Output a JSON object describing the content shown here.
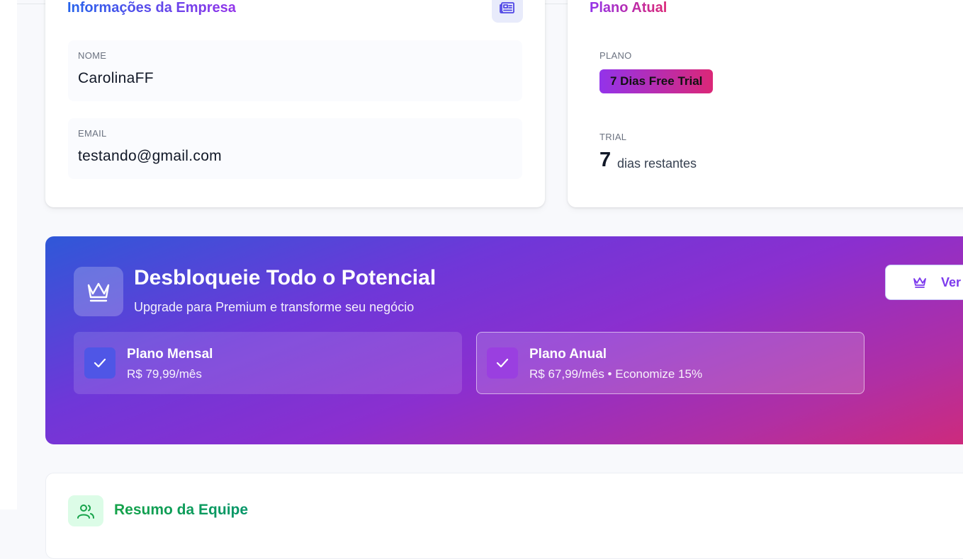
{
  "company_card": {
    "title": "Informações da Empresa",
    "icon": "newspaper-icon",
    "fields": [
      {
        "label": "NOME",
        "value": "CarolinaFF"
      },
      {
        "label": "EMAIL",
        "value": "testando@gmail.com"
      }
    ]
  },
  "plan_card": {
    "title": "Plano Atual",
    "plan_label": "PLANO",
    "plan_value": "7 Dias Free Trial",
    "trial_label": "TRIAL",
    "trial_days": "7",
    "trial_text": "dias restantes"
  },
  "upgrade_banner": {
    "icon": "crown-icon",
    "title": "Desbloqueie Todo o Potencial",
    "subtitle": "Upgrade para Premium e transforme seu negócio",
    "cta_label": "Ver",
    "options": [
      {
        "name": "Plano Mensal",
        "price": "R$ 79,99/mês"
      },
      {
        "name": "Plano Anual",
        "price": "R$ 67,99/mês • Economize 15%"
      }
    ]
  },
  "team_card": {
    "title": "Resumo da Equipe",
    "icon": "users-icon"
  },
  "colors": {
    "accent_blue": "#2563eb",
    "accent_purple": "#9333ea",
    "accent_pink": "#db2777",
    "team_green": "#16a34a"
  }
}
